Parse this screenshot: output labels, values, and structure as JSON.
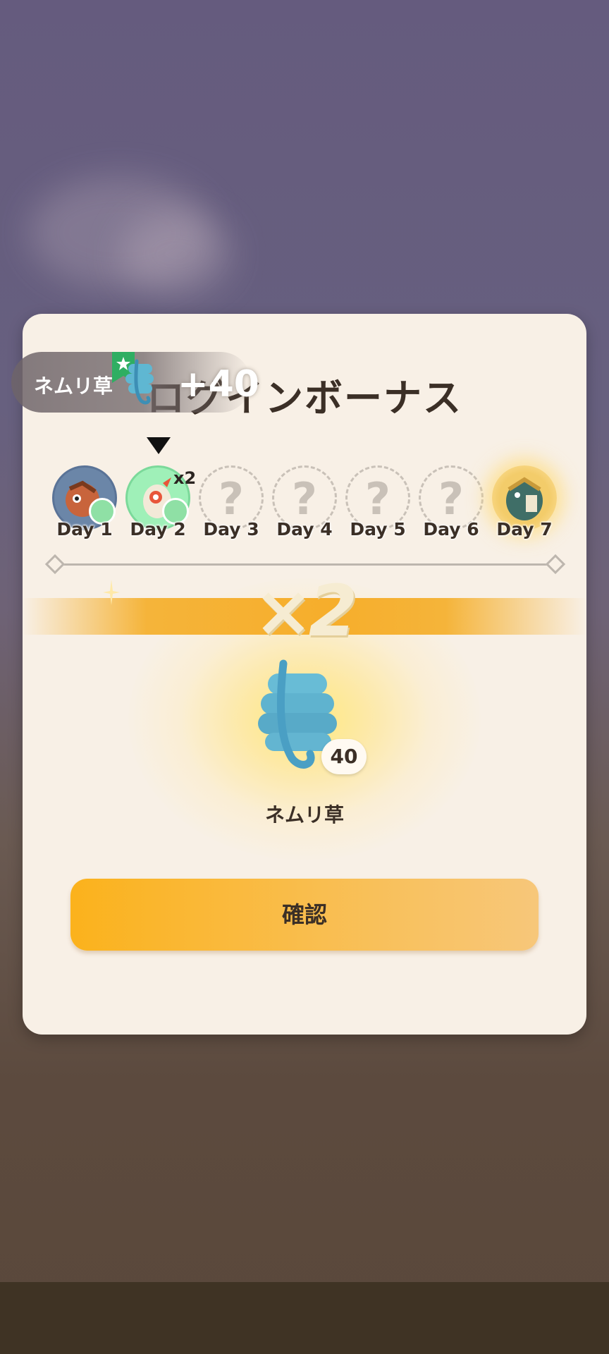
{
  "modal": {
    "title": "ログインボーナス"
  },
  "toast": {
    "item_name": "ネムリ草",
    "amount": "+40"
  },
  "days": [
    {
      "label": "Day 1",
      "state": "claimed"
    },
    {
      "label": "Day 2",
      "state": "today",
      "multiplier": "x2"
    },
    {
      "label": "Day 3",
      "state": "locked",
      "placeholder": "?"
    },
    {
      "label": "Day 4",
      "state": "locked",
      "placeholder": "?"
    },
    {
      "label": "Day 5",
      "state": "locked",
      "placeholder": "?"
    },
    {
      "label": "Day 6",
      "state": "locked",
      "placeholder": "?"
    },
    {
      "label": "Day 7",
      "state": "bonus"
    }
  ],
  "reward": {
    "multiplier": "×2",
    "count": "40",
    "name": "ネムリ草"
  },
  "confirm_button": {
    "label": "確認"
  },
  "colors": {
    "accent": "#f6ae2b",
    "panel": "#f8f0e6",
    "text": "#3b2f26"
  }
}
